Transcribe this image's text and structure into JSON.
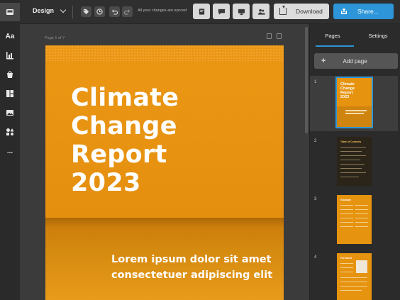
{
  "topbar": {
    "mode_label": "Design",
    "sync_status": "All your changes are synced",
    "download_label": "Download",
    "share_label": "Share..."
  },
  "rail": {
    "items": [
      {
        "name": "layout-icon",
        "active": true
      },
      {
        "name": "text-icon",
        "label": "Aa"
      },
      {
        "name": "chart-icon"
      },
      {
        "name": "bag-icon"
      },
      {
        "name": "pages-icon"
      },
      {
        "name": "image-icon"
      },
      {
        "name": "shapes-icon"
      },
      {
        "name": "more-icon",
        "label": "..."
      }
    ]
  },
  "canvas": {
    "page_label": "Page 1 of 7",
    "title_lines": [
      "Climate",
      "Change",
      "Report",
      "2023"
    ],
    "subtitle_lines": [
      "Lorem ipsum dolor sit amet",
      "consectetuer adipiscing elit"
    ]
  },
  "panel": {
    "tabs": [
      "Pages",
      "Settings"
    ],
    "active_tab": "Pages",
    "add_page_label": "Add page",
    "thumbnails": [
      {
        "num": "1",
        "title": "Climate Change Report 2023",
        "selected": true
      },
      {
        "num": "2",
        "title": "Table of Contents"
      },
      {
        "num": "3",
        "title": "Glossary"
      },
      {
        "num": "4",
        "title": "Foreword"
      }
    ]
  },
  "colors": {
    "accent": "#2d95d8",
    "page_orange": "#e6930f",
    "background": "#3b3b3b"
  }
}
